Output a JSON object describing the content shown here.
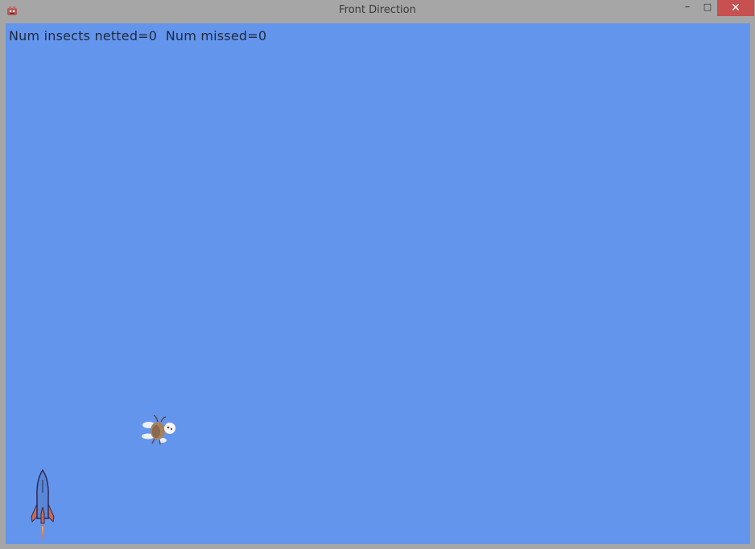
{
  "window": {
    "title": "Front Direction",
    "app_icon": "pygame-snake-icon",
    "buttons": {
      "minimize": "–",
      "maximize": "□",
      "close": "✕"
    }
  },
  "game": {
    "background_color": "#6495ed",
    "hud": {
      "netted_label": "Num insects netted=0",
      "missed_label": "Num missed=0"
    },
    "sprites": {
      "insect": "flying-insect-icon",
      "rocket": "rocket-icon"
    }
  }
}
